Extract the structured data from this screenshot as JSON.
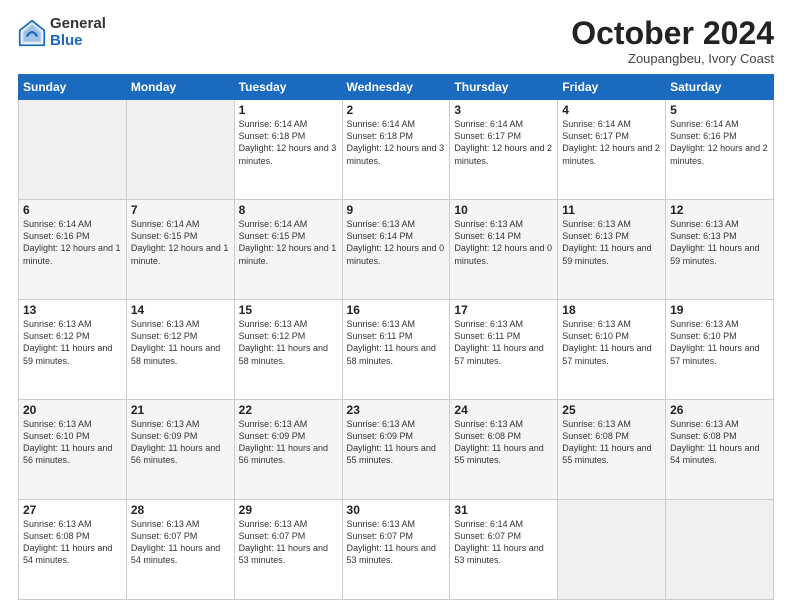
{
  "logo": {
    "general": "General",
    "blue": "Blue"
  },
  "header": {
    "month": "October 2024",
    "location": "Zoupangbeu, Ivory Coast"
  },
  "weekdays": [
    "Sunday",
    "Monday",
    "Tuesday",
    "Wednesday",
    "Thursday",
    "Friday",
    "Saturday"
  ],
  "weeks": [
    [
      {
        "day": "",
        "info": ""
      },
      {
        "day": "",
        "info": ""
      },
      {
        "day": "1",
        "info": "Sunrise: 6:14 AM\nSunset: 6:18 PM\nDaylight: 12 hours\nand 3 minutes."
      },
      {
        "day": "2",
        "info": "Sunrise: 6:14 AM\nSunset: 6:18 PM\nDaylight: 12 hours\nand 3 minutes."
      },
      {
        "day": "3",
        "info": "Sunrise: 6:14 AM\nSunset: 6:17 PM\nDaylight: 12 hours\nand 2 minutes."
      },
      {
        "day": "4",
        "info": "Sunrise: 6:14 AM\nSunset: 6:17 PM\nDaylight: 12 hours\nand 2 minutes."
      },
      {
        "day": "5",
        "info": "Sunrise: 6:14 AM\nSunset: 6:16 PM\nDaylight: 12 hours\nand 2 minutes."
      }
    ],
    [
      {
        "day": "6",
        "info": "Sunrise: 6:14 AM\nSunset: 6:16 PM\nDaylight: 12 hours\nand 1 minute."
      },
      {
        "day": "7",
        "info": "Sunrise: 6:14 AM\nSunset: 6:15 PM\nDaylight: 12 hours\nand 1 minute."
      },
      {
        "day": "8",
        "info": "Sunrise: 6:14 AM\nSunset: 6:15 PM\nDaylight: 12 hours\nand 1 minute."
      },
      {
        "day": "9",
        "info": "Sunrise: 6:13 AM\nSunset: 6:14 PM\nDaylight: 12 hours\nand 0 minutes."
      },
      {
        "day": "10",
        "info": "Sunrise: 6:13 AM\nSunset: 6:14 PM\nDaylight: 12 hours\nand 0 minutes."
      },
      {
        "day": "11",
        "info": "Sunrise: 6:13 AM\nSunset: 6:13 PM\nDaylight: 11 hours\nand 59 minutes."
      },
      {
        "day": "12",
        "info": "Sunrise: 6:13 AM\nSunset: 6:13 PM\nDaylight: 11 hours\nand 59 minutes."
      }
    ],
    [
      {
        "day": "13",
        "info": "Sunrise: 6:13 AM\nSunset: 6:12 PM\nDaylight: 11 hours\nand 59 minutes."
      },
      {
        "day": "14",
        "info": "Sunrise: 6:13 AM\nSunset: 6:12 PM\nDaylight: 11 hours\nand 58 minutes."
      },
      {
        "day": "15",
        "info": "Sunrise: 6:13 AM\nSunset: 6:12 PM\nDaylight: 11 hours\nand 58 minutes."
      },
      {
        "day": "16",
        "info": "Sunrise: 6:13 AM\nSunset: 6:11 PM\nDaylight: 11 hours\nand 58 minutes."
      },
      {
        "day": "17",
        "info": "Sunrise: 6:13 AM\nSunset: 6:11 PM\nDaylight: 11 hours\nand 57 minutes."
      },
      {
        "day": "18",
        "info": "Sunrise: 6:13 AM\nSunset: 6:10 PM\nDaylight: 11 hours\nand 57 minutes."
      },
      {
        "day": "19",
        "info": "Sunrise: 6:13 AM\nSunset: 6:10 PM\nDaylight: 11 hours\nand 57 minutes."
      }
    ],
    [
      {
        "day": "20",
        "info": "Sunrise: 6:13 AM\nSunset: 6:10 PM\nDaylight: 11 hours\nand 56 minutes."
      },
      {
        "day": "21",
        "info": "Sunrise: 6:13 AM\nSunset: 6:09 PM\nDaylight: 11 hours\nand 56 minutes."
      },
      {
        "day": "22",
        "info": "Sunrise: 6:13 AM\nSunset: 6:09 PM\nDaylight: 11 hours\nand 56 minutes."
      },
      {
        "day": "23",
        "info": "Sunrise: 6:13 AM\nSunset: 6:09 PM\nDaylight: 11 hours\nand 55 minutes."
      },
      {
        "day": "24",
        "info": "Sunrise: 6:13 AM\nSunset: 6:08 PM\nDaylight: 11 hours\nand 55 minutes."
      },
      {
        "day": "25",
        "info": "Sunrise: 6:13 AM\nSunset: 6:08 PM\nDaylight: 11 hours\nand 55 minutes."
      },
      {
        "day": "26",
        "info": "Sunrise: 6:13 AM\nSunset: 6:08 PM\nDaylight: 11 hours\nand 54 minutes."
      }
    ],
    [
      {
        "day": "27",
        "info": "Sunrise: 6:13 AM\nSunset: 6:08 PM\nDaylight: 11 hours\nand 54 minutes."
      },
      {
        "day": "28",
        "info": "Sunrise: 6:13 AM\nSunset: 6:07 PM\nDaylight: 11 hours\nand 54 minutes."
      },
      {
        "day": "29",
        "info": "Sunrise: 6:13 AM\nSunset: 6:07 PM\nDaylight: 11 hours\nand 53 minutes."
      },
      {
        "day": "30",
        "info": "Sunrise: 6:13 AM\nSunset: 6:07 PM\nDaylight: 11 hours\nand 53 minutes."
      },
      {
        "day": "31",
        "info": "Sunrise: 6:14 AM\nSunset: 6:07 PM\nDaylight: 11 hours\nand 53 minutes."
      },
      {
        "day": "",
        "info": ""
      },
      {
        "day": "",
        "info": ""
      }
    ]
  ]
}
